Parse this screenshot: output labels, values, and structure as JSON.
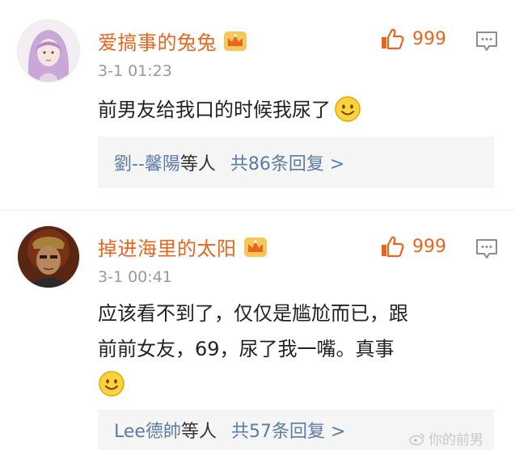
{
  "comments": [
    {
      "username": "爱搞事的兔兔",
      "likes": "999",
      "time": "3-1 01:23",
      "text_lines": [
        "前男友给我口的时候我尿了"
      ],
      "reply_names": "劉--馨陽",
      "reply_suffix": "等人",
      "reply_total": "共86条回复 >"
    },
    {
      "username": "掉进海里的太阳",
      "likes": "999",
      "time": "3-1 00:41",
      "text_lines": [
        "应该看不到了，仅仅是尴尬而已，跟",
        "前前女友，69，尿了我一嘴。真事"
      ],
      "reply_names": "Lee德帥",
      "reply_suffix": "等人",
      "reply_total": "共57条回复 >"
    }
  ],
  "icons": {
    "badge": "crown-vip-icon",
    "like": "thumbs-up-icon",
    "reply": "comment-bubble-icon",
    "emoji": "smiley-emoji"
  },
  "colors": {
    "username": "#e8651d",
    "reply_link": "#5c7ca8",
    "timestamp": "#999999"
  },
  "watermark": "你的前男"
}
